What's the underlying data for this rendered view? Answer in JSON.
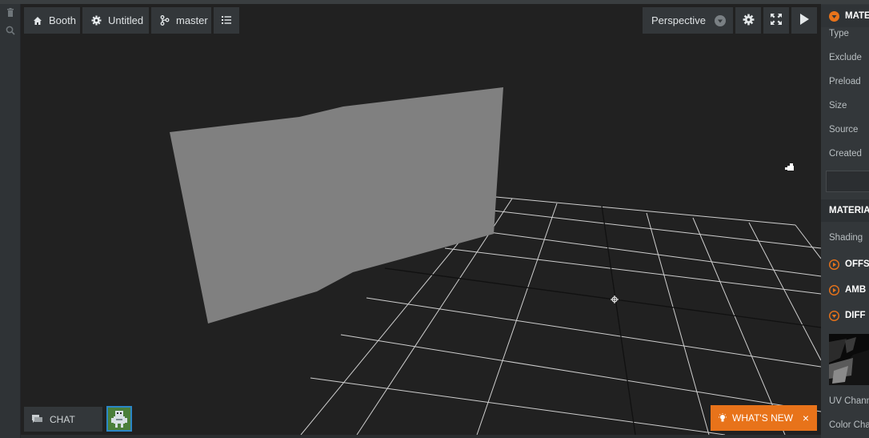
{
  "sidebar": {
    "items": [
      {
        "icon": "trash-icon"
      },
      {
        "icon": "search-icon"
      }
    ]
  },
  "toolbar": {
    "project_label": "Booth",
    "scene_label": "Untitled",
    "branch_label": "master",
    "camera_label": "Perspective"
  },
  "inspector": {
    "asset_header": "MATE",
    "fields": [
      "Type",
      "Exclude",
      "Preload",
      "Size",
      "Source",
      "Created"
    ],
    "material_header": "MATERIA",
    "shading_label": "Shading",
    "sections": [
      "OFFS",
      "AMB",
      "DIFF"
    ],
    "uv_label": "UV Chann",
    "color_label": "Color Cha"
  },
  "footer": {
    "chat_label": "CHAT",
    "whats_new_label": "WHAT'S NEW",
    "close_symbol": "×"
  },
  "colors": {
    "accent": "#e8731a",
    "panel": "#33373a",
    "viewport": "#212121",
    "plane": "#808080"
  }
}
